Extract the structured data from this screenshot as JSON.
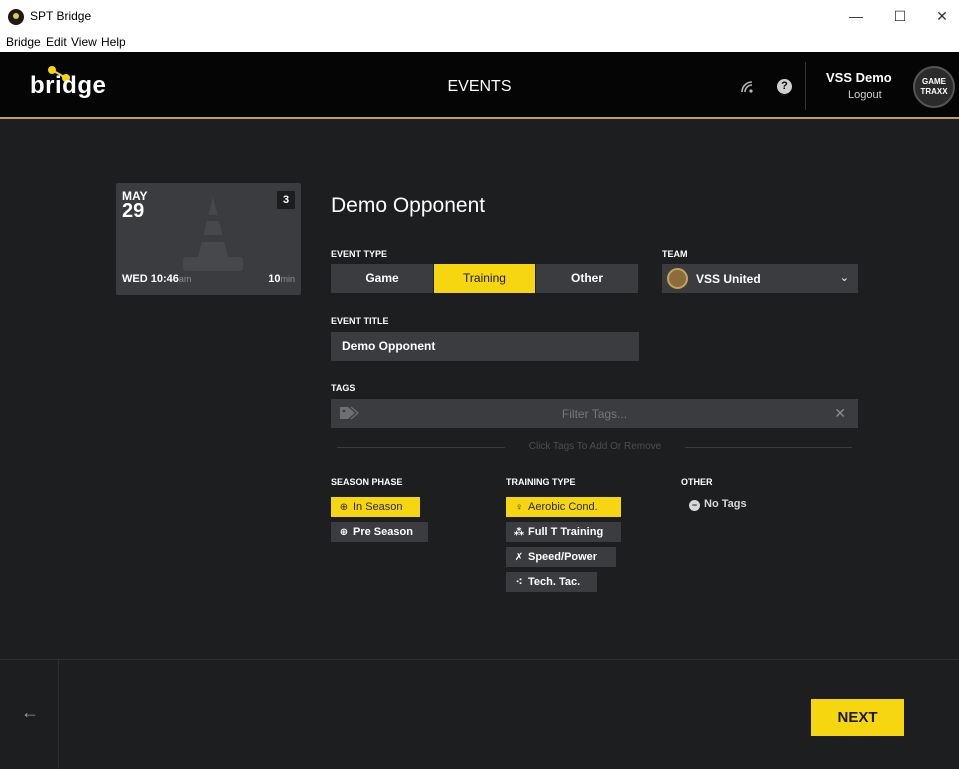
{
  "window": {
    "title": "SPT Bridge",
    "minimize": "—",
    "maximize": "☐",
    "close": "✕"
  },
  "menu": [
    "Bridge",
    "Edit",
    "View",
    "Help"
  ],
  "header": {
    "logo": "bridge",
    "title": "EVENTS",
    "user_name": "VSS Demo",
    "logout": "Logout",
    "avatar_text_1": "GAME",
    "avatar_text_2": "TRAXX"
  },
  "event_card": {
    "month": "MAY",
    "day": "29",
    "badge": "3",
    "weekday_time": "WED 10:46",
    "ampm": "am",
    "duration": "10",
    "duration_unit": "min"
  },
  "form": {
    "heading": "Demo Opponent",
    "event_type_label": "EVENT TYPE",
    "event_types": [
      {
        "label": "Game",
        "active": false
      },
      {
        "label": "Training",
        "active": true
      },
      {
        "label": "Other",
        "active": false
      }
    ],
    "team_label": "TEAM",
    "team_value": "VSS United",
    "event_title_label": "EVENT TITLE",
    "event_title_value": "Demo Opponent",
    "tags_label": "TAGS",
    "tags_placeholder": "Filter Tags...",
    "tags_hint": "Click Tags To Add Or Remove"
  },
  "tag_groups": {
    "season_phase": {
      "label": "SEASON PHASE",
      "items": [
        {
          "label": "In Season",
          "active": true
        },
        {
          "label": "Pre Season",
          "active": false
        }
      ]
    },
    "training_type": {
      "label": "TRAINING TYPE",
      "items": [
        {
          "label": "Aerobic Cond.",
          "active": true
        },
        {
          "label": "Full T Training",
          "active": false
        },
        {
          "label": "Speed/Power",
          "active": false
        },
        {
          "label": "Tech. Tac.",
          "active": false
        }
      ]
    },
    "other": {
      "label": "OTHER",
      "items": [
        {
          "label": "No Tags",
          "active": false
        }
      ]
    }
  },
  "footer": {
    "back": "←",
    "next": "NEXT"
  },
  "colors": {
    "accent": "#f6d511",
    "background": "#1d1e20",
    "panel": "#3b3c3f"
  }
}
